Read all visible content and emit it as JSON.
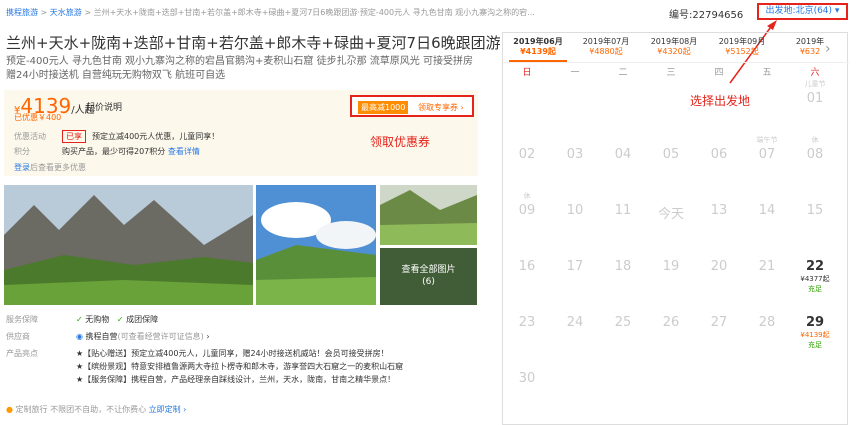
{
  "breadcrumb": {
    "home": "携程旅游",
    "city": "天水旅游",
    "trail": "> 兰州+天水+陇南+迭部+甘南+若尔盖+郎木寺+碌曲+夏河7日6晚跟团游·预定-400元人 寻九色甘南 观小九寨沟之称的宕..."
  },
  "product_id": "编号:22794656",
  "departure": {
    "label": "出发地:北京(64)",
    "icon": "chevron-down-icon"
  },
  "title": "兰州+天水+陇南+迭部+甘南+若尔盖+郎木寺+碌曲+夏河7日6晚跟团游",
  "subtitle": "预定-400元人 寻九色甘南 观小九寨沟之称的宕昌官鹅沟+麦积山石窟 徒步扎尕那 流草原风光 可接受拼房 赠24小时接送机 自营纯玩无购物双飞 航班可自选",
  "price": {
    "currency": "¥",
    "amount": "4139",
    "unit": "/人起",
    "note": "起价说明",
    "original": "已优惠￥400"
  },
  "coupon": {
    "badge": "最高减1000",
    "link": "领取专享券 ›"
  },
  "promo": {
    "label": "优惠活动",
    "tag": "已享",
    "text": "预定立减400元人优惠，儿童同享！"
  },
  "points": {
    "label": "积分",
    "text": "购买产品，最少可得207积分",
    "link": "查看详情"
  },
  "login": {
    "link": "登录",
    "text": "后查看更多优惠"
  },
  "annotations": {
    "coupon": "领取优惠券",
    "departure": "选择出发地"
  },
  "gallery": {
    "more": "查看全部图片",
    "count": "(6)"
  },
  "service": {
    "label": "服务保障",
    "items": [
      "无购物",
      "成团保障"
    ]
  },
  "supplier": {
    "label": "供应商",
    "name": "携程自营",
    "note": "(可查看经营许可证信息)",
    "arrow": "›"
  },
  "highlights": {
    "label": "产品亮点",
    "items": [
      "★【贴心赠送】预定立减400元人，儿童同享，赠24小时接送机威站！会员可接受拼房！",
      "★【缤纷景观】特意安排植鲁源两大寺拉卜楞寺和郎木寺，游享誉四大石窟之一的麦积山石窟",
      "★【服务保障】携程自营，产品经理亲自踩线设计，兰州，天水，陇南，甘南之精华景点！"
    ]
  },
  "bottom": {
    "text": "定制旅行  不限团不自助，不让你费心",
    "link": "立即定制 ›"
  },
  "calendar": {
    "months": [
      {
        "label": "2019年06月",
        "price": "¥4139起",
        "active": true
      },
      {
        "label": "2019年07月",
        "price": "¥4880起",
        "active": false
      },
      {
        "label": "2019年08月",
        "price": "¥4320起",
        "active": false
      },
      {
        "label": "2019年09月",
        "price": "¥5152起",
        "active": false
      },
      {
        "label": "2019年",
        "price": "¥632",
        "active": false
      }
    ],
    "next_icon": "chevron-right-icon",
    "weekdays": [
      "日",
      "一",
      "二",
      "三",
      "四",
      "五",
      "六"
    ],
    "days": [
      {
        "d": "01",
        "hol": "儿童节",
        "wd": 6,
        "row": 0
      },
      {
        "d": "02",
        "wd": 0,
        "row": 1
      },
      {
        "d": "03",
        "wd": 1,
        "row": 1
      },
      {
        "d": "04",
        "wd": 2,
        "row": 1
      },
      {
        "d": "05",
        "wd": 3,
        "row": 1
      },
      {
        "d": "06",
        "wd": 4,
        "row": 1
      },
      {
        "d": "07",
        "hol": "端午节",
        "wd": 5,
        "row": 1
      },
      {
        "d": "08",
        "hol": "休",
        "wd": 6,
        "row": 1
      },
      {
        "d": "09",
        "hol": "休",
        "wd": 0,
        "row": 2
      },
      {
        "d": "10",
        "wd": 1,
        "row": 2
      },
      {
        "d": "11",
        "wd": 2,
        "row": 2
      },
      {
        "d": "今天",
        "wd": 3,
        "row": 2
      },
      {
        "d": "13",
        "wd": 4,
        "row": 2
      },
      {
        "d": "14",
        "wd": 5,
        "row": 2
      },
      {
        "d": "15",
        "wd": 6,
        "row": 2
      },
      {
        "d": "16",
        "wd": 0,
        "row": 3
      },
      {
        "d": "17",
        "wd": 1,
        "row": 3
      },
      {
        "d": "18",
        "wd": 2,
        "row": 3
      },
      {
        "d": "19",
        "wd": 3,
        "row": 3
      },
      {
        "d": "20",
        "wd": 4,
        "row": 3
      },
      {
        "d": "21",
        "wd": 5,
        "row": 3
      },
      {
        "d": "22",
        "wd": 6,
        "row": 3,
        "price": "¥4377起",
        "status": "充足",
        "pc": "#333"
      },
      {
        "d": "23",
        "wd": 0,
        "row": 4
      },
      {
        "d": "24",
        "wd": 1,
        "row": 4
      },
      {
        "d": "25",
        "wd": 2,
        "row": 4
      },
      {
        "d": "26",
        "wd": 3,
        "row": 4
      },
      {
        "d": "27",
        "wd": 4,
        "row": 4
      },
      {
        "d": "28",
        "wd": 5,
        "row": 4
      },
      {
        "d": "29",
        "wd": 6,
        "row": 4,
        "price": "¥4139起",
        "status": "充足",
        "pc": "#ff6600"
      },
      {
        "d": "30",
        "wd": 0,
        "row": 5
      }
    ]
  }
}
